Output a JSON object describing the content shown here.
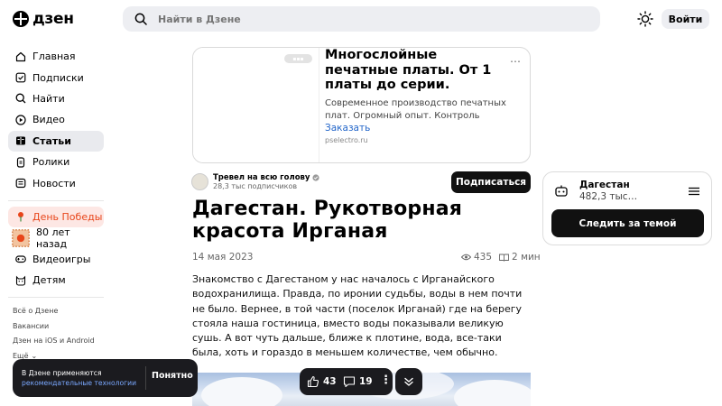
{
  "header": {
    "logo": "дзен",
    "search_placeholder": "Найти в Дзене",
    "login": "Войти"
  },
  "sidebar": {
    "items": [
      {
        "label": "Главная",
        "icon": "home-icon"
      },
      {
        "label": "Подписки",
        "icon": "subscriptions-icon"
      },
      {
        "label": "Найти",
        "icon": "search-icon"
      },
      {
        "label": "Видео",
        "icon": "play-icon"
      },
      {
        "label": "Статьи",
        "icon": "articles-icon",
        "active": true
      },
      {
        "label": "Ролики",
        "icon": "shorts-icon"
      },
      {
        "label": "Новости",
        "icon": "news-icon"
      },
      {
        "label": "День Победы",
        "icon": "carnation-icon"
      },
      {
        "label": "80 лет назад",
        "icon": "stamp-icon"
      },
      {
        "label": "Видеоигры",
        "icon": "gamepad-icon"
      },
      {
        "label": "Детям",
        "icon": "kids-icon"
      }
    ],
    "footer_links": [
      "Всё о Дзене",
      "Вакансии",
      "Дзен на iOS и Android",
      "Ещё"
    ]
  },
  "ad": {
    "title": "Многослойные печатные платы. От 1 платы до серии.",
    "description": "Современное производство печатных плат. Огромный опыт. Контроль качеств…",
    "cta": "Заказать",
    "domain": "pselectro.ru"
  },
  "channel": {
    "name": "Тревел на всю голову",
    "subscribers": "28,3 тыс подписчиков",
    "subscribe": "Подписаться"
  },
  "article": {
    "title": "Дагестан. Рукотворная красота Ирганая",
    "date": "14 мая 2023",
    "views": "435",
    "read_time": "2 мин",
    "body": "Знакомство с Дагестаном у нас началось с Ирганайского водохранилища. Правда, по иронии судьбы, воды в нем почти не было. Вернее, в той части (поселок Ирганай) где на берегу стояла наша гостиница, вместо воды показывали великую сушь. А вот чуть дальше, ближе к плотине, вода, все-таки была, хоть и гораздо в меньшем количестве, чем обычно."
  },
  "topic": {
    "name": "Дагестан",
    "count": "482,3 тыс…",
    "follow": "Следить за темой"
  },
  "toast": {
    "text": "В Дзене применяются",
    "link": "рекомендательные технологии",
    "button": "Понятно"
  },
  "actions": {
    "likes": "43",
    "comments": "19"
  },
  "colors": {
    "accent_dark": "#1b1b1f",
    "victory": "#e8451a",
    "link": "#2265c9"
  }
}
